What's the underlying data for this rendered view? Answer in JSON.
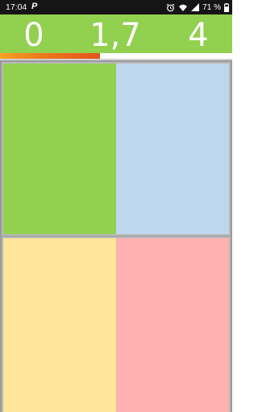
{
  "status_bar": {
    "time": "17:04",
    "app_icon": "P",
    "battery_percent": "71 %",
    "icons": [
      "alarm-icon",
      "wifi-icon",
      "signal-icon",
      "battery-icon"
    ]
  },
  "header": {
    "background": "#92d050",
    "scores": {
      "left": "0",
      "middle": "1,7",
      "right": "4"
    }
  },
  "progress": {
    "fraction": 0.43,
    "colors": [
      "#f5a020",
      "#e4541a"
    ]
  },
  "tiles": {
    "top_left": {
      "color": "#92d050",
      "name": "green"
    },
    "top_right": {
      "color": "#bdd7ee",
      "name": "blue"
    },
    "bottom_left": {
      "color": "#ffe699",
      "name": "yellow"
    },
    "bottom_right": {
      "color": "#ffb0b0",
      "name": "red"
    }
  }
}
